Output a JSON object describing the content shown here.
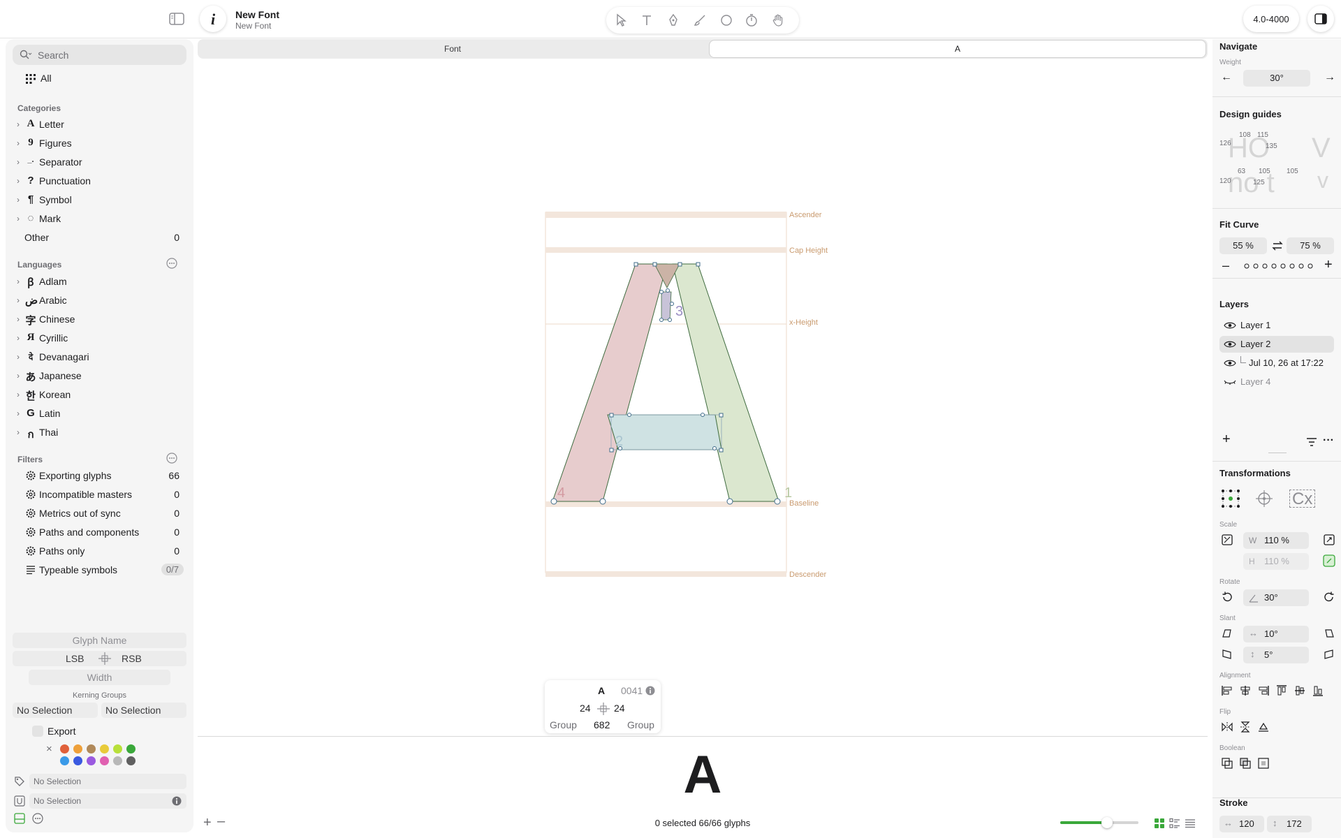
{
  "window": {
    "title": "New Font",
    "subtitle": "New Font",
    "info_glyph": "i",
    "range_label": "4.0-4000"
  },
  "sidebar": {
    "search_placeholder": "Search",
    "all_label": "All",
    "categories_title": "Categories",
    "categories": [
      {
        "glyph": "A",
        "label": "Letter"
      },
      {
        "glyph": "9",
        "label": "Figures"
      },
      {
        "glyph": "_.",
        "label": "Separator"
      },
      {
        "glyph": "?",
        "label": "Punctuation"
      },
      {
        "glyph": "¶",
        "label": "Symbol"
      },
      {
        "glyph": "◌",
        "label": "Mark"
      }
    ],
    "other": {
      "label": "Other",
      "count": "0"
    },
    "languages_title": "Languages",
    "languages": [
      {
        "glyph": "ꞵ",
        "label": "Adlam"
      },
      {
        "glyph": "ض",
        "label": "Arabic"
      },
      {
        "glyph": "字",
        "label": "Chinese"
      },
      {
        "glyph": "Я",
        "label": "Cyrillic"
      },
      {
        "glyph": "दे",
        "label": "Devanagari"
      },
      {
        "glyph": "あ",
        "label": "Japanese"
      },
      {
        "glyph": "한",
        "label": "Korean"
      },
      {
        "glyph": "G",
        "label": "Latin"
      },
      {
        "glyph": "ก",
        "label": "Thai"
      }
    ],
    "filters_title": "Filters",
    "filters": [
      {
        "label": "Exporting glyphs",
        "count": "66"
      },
      {
        "label": "Incompatible masters",
        "count": "0"
      },
      {
        "label": "Metrics out of sync",
        "count": "0"
      },
      {
        "label": "Paths and components",
        "count": "0"
      },
      {
        "label": "Paths only",
        "count": "0"
      }
    ],
    "typeable": {
      "label": "Typeable symbols",
      "count": "0/7"
    },
    "glyph_name_placeholder": "Glyph Name",
    "lsb": "LSB",
    "rsb": "RSB",
    "width": "Width",
    "kerning_groups": "Kerning Groups",
    "kern_left": "No Selection",
    "kern_right": "No Selection",
    "export_label": "Export",
    "color_close": "×",
    "tag_field": "No Selection",
    "unicode_field": "No Selection",
    "swatches": [
      "#e0603a",
      "#eea03a",
      "#b0895a",
      "#e8cb3a",
      "#b8e03a",
      "#3aa83a",
      "#3a9ae8",
      "#3a5ae0",
      "#9a5ae0",
      "#e060b0",
      "#b8b8b8",
      "#606060"
    ]
  },
  "tabs": {
    "font": "Font",
    "glyph": "A"
  },
  "canvas": {
    "metrics": {
      "ascender": "Ascender",
      "cap_height": "Cap Height",
      "x_height": "x-Height",
      "baseline": "Baseline",
      "descender": "Descender"
    },
    "shape_labels": {
      "one": "1",
      "two": "2",
      "three": "3",
      "four": "4"
    }
  },
  "info_card": {
    "glyph": "A",
    "unicode": "0041",
    "lsb": "24",
    "rsb": "24",
    "left_group": "Group",
    "width": "682",
    "right_group": "Group"
  },
  "preview": {
    "glyph": "A",
    "status": "0 selected 66/66 glyphs",
    "zoom_fraction": 0.6
  },
  "right": {
    "navigate_title": "Navigate",
    "weight_label": "Weight",
    "weight_value": "30°",
    "design_guides_title": "Design guides",
    "guides": {
      "top": [
        "126",
        "108",
        "115",
        "135"
      ],
      "bottom": [
        "120",
        "63",
        "105",
        "125",
        "105"
      ],
      "word_top": "HO",
      "word_top2": "V",
      "word_bottom": "no t",
      "word_bottom2": "v"
    },
    "fit_curve_title": "Fit Curve",
    "fit_left": "55 %",
    "fit_right": "75 %",
    "layers_title": "Layers",
    "layers": [
      {
        "name": "Layer 1"
      },
      {
        "name": "Layer 2"
      },
      {
        "name": "Jul 10, 26 at 17:22"
      },
      {
        "name": "Layer 4"
      }
    ],
    "transformations_title": "Transformations",
    "cx_label": "Cx",
    "scale_label": "Scale",
    "scale_w_key": "W",
    "scale_w": "110 %",
    "scale_h_key": "H",
    "scale_h": "110 %",
    "rotate_label": "Rotate",
    "rotate_value": "30°",
    "slant_label": "Slant",
    "slant_x": "10°",
    "slant_y": "5°",
    "alignment_label": "Alignment",
    "flip_label": "Flip",
    "boolean_label": "Boolean",
    "stroke_title": "Stroke",
    "stroke_w": "120",
    "stroke_h": "172"
  }
}
